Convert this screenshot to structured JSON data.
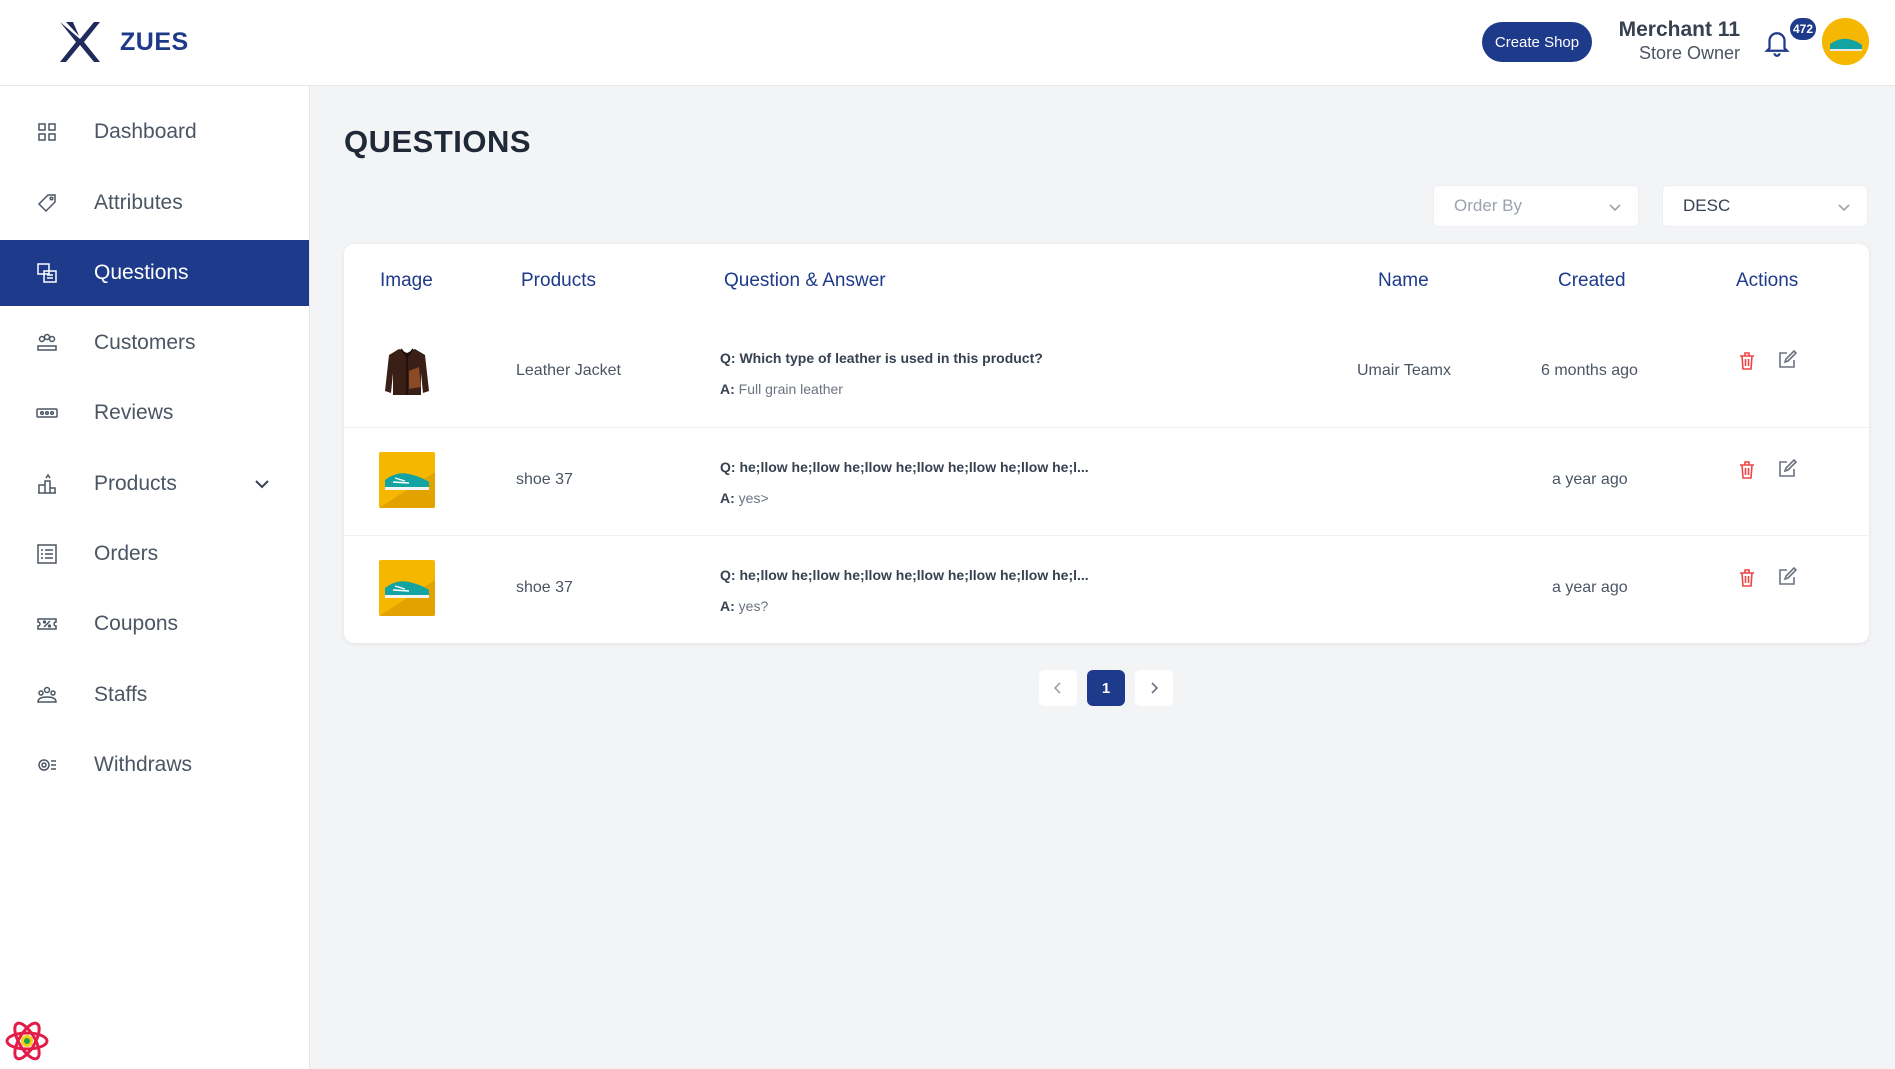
{
  "brand": {
    "name": "ZUES"
  },
  "header": {
    "create_shop_label": "Create Shop",
    "user_name": "Merchant 11",
    "user_role": "Store Owner",
    "notification_count": "472"
  },
  "sidebar": {
    "items": [
      {
        "label": "Dashboard",
        "icon": "grid-icon"
      },
      {
        "label": "Attributes",
        "icon": "tag-icon"
      },
      {
        "label": "Questions",
        "icon": "question-card-icon",
        "active": true
      },
      {
        "label": "Customers",
        "icon": "users-group-icon"
      },
      {
        "label": "Reviews",
        "icon": "rating-icon"
      },
      {
        "label": "Products",
        "icon": "products-icon",
        "expandable": true
      },
      {
        "label": "Orders",
        "icon": "list-icon"
      },
      {
        "label": "Coupons",
        "icon": "coupon-icon"
      },
      {
        "label": "Staffs",
        "icon": "staff-icon"
      },
      {
        "label": "Withdraws",
        "icon": "withdraw-icon"
      }
    ]
  },
  "main": {
    "title": "QUESTIONS",
    "order_by_placeholder": "Order By",
    "direction_value": "DESC",
    "table": {
      "headers": [
        "Image",
        "Products",
        "Question & Answer",
        "Name",
        "Created",
        "Actions"
      ],
      "rows": [
        {
          "image": "leather-jacket",
          "product": "Leather Jacket",
          "question": "Q: Which type of leather is used in this product?",
          "answer_prefix": "A:",
          "answer": "Full grain leather",
          "name": "Umair Teamx",
          "created": "6 months ago"
        },
        {
          "image": "shoe",
          "product": "shoe 37",
          "question": "Q: he;llow he;llow he;llow he;llow he;llow he;llow he;l...",
          "answer_prefix": "A:",
          "answer": "yes>",
          "name": "",
          "created": "a year ago"
        },
        {
          "image": "shoe",
          "product": "shoe 37",
          "question": "Q: he;llow he;llow he;llow he;llow he;llow he;llow he;l...",
          "answer_prefix": "A:",
          "answer": "yes?",
          "name": "",
          "created": "a year ago"
        }
      ]
    },
    "pagination": {
      "current": "1"
    }
  },
  "colors": {
    "primary": "#1e3a8a",
    "delete": "#ef4444",
    "background": "#f3f4f6"
  }
}
